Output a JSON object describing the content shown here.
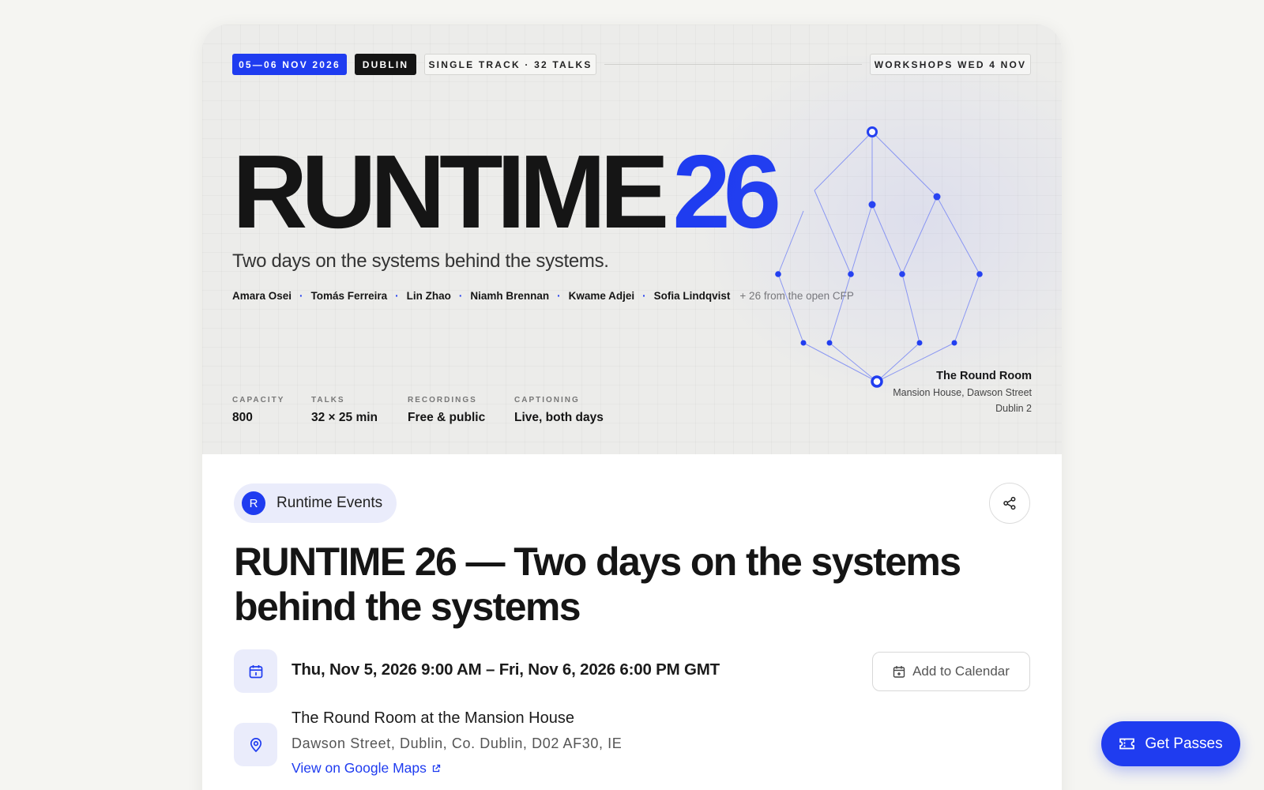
{
  "hero": {
    "date_tag": "05—06 NOV 2026",
    "city_tag": "DUBLIN",
    "track_tag": "SINGLE TRACK · 32 TALKS",
    "workshops_tag": "WORKSHOPS WED 4 NOV",
    "title_word": "RUNTIME",
    "title_num": "26",
    "tagline": "Two days on the systems behind the systems.",
    "speakers": [
      "Amara Osei",
      "Tomás Ferreira",
      "Lin Zhao",
      "Niamh Brennan",
      "Kwame Adjei",
      "Sofia Lindqvist"
    ],
    "speakers_more": "+ 26 from the open CFP",
    "stats": [
      {
        "label": "CAPACITY",
        "value": "800"
      },
      {
        "label": "TALKS",
        "value": "32 × 25 min"
      },
      {
        "label": "RECORDINGS",
        "value": "Free & public"
      },
      {
        "label": "CAPTIONING",
        "value": "Live, both days"
      }
    ],
    "venue": {
      "name": "The Round Room",
      "street": "Mansion House, Dawson Street",
      "city": "Dublin 2"
    }
  },
  "organizer": {
    "initial": "R",
    "name": "Runtime Events"
  },
  "event": {
    "title": "RUNTIME 26 — Two days on the systems behind the systems",
    "datetime": "Thu, Nov 5, 2026 9:00 AM – Fri, Nov 6, 2026 6:00 PM GMT",
    "add_calendar": "Add to Calendar",
    "location_name": "The Round Room at the Mansion House",
    "location_address": "Dawson Street, Dublin, Co. Dublin, D02 AF30, IE",
    "maps_link": "View on Google Maps"
  },
  "cta": {
    "get_passes": "Get Passes"
  },
  "icons": {
    "share": "share-icon",
    "calendar": "calendar-icon",
    "location": "map-pin-icon",
    "external": "external-link-icon",
    "ticket": "ticket-icon"
  },
  "colors": {
    "accent": "#1f3cf0",
    "dark": "#141414",
    "background": "#f5f5f2",
    "soft_accent": "#eaecfb"
  }
}
